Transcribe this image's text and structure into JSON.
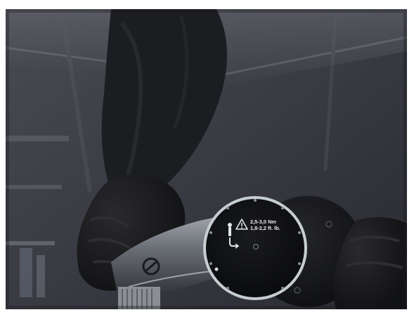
{
  "photo": {
    "subject": "gloved-hands-holding-torque-tool-with-two-round-discs",
    "colors": {
      "background": "#3a3a42",
      "glove": "#1a1b1e",
      "disc": "#0f1013",
      "disc_rim": "#c8cfd2",
      "tool_body": "#7c7f86"
    }
  },
  "disc_label": {
    "line1": "2,5-3,0 Nm",
    "line2": "1,8-2,2 ft. lb."
  },
  "icons": {
    "warning": "warning-triangle-icon",
    "torque": "torque-tool-icon"
  }
}
